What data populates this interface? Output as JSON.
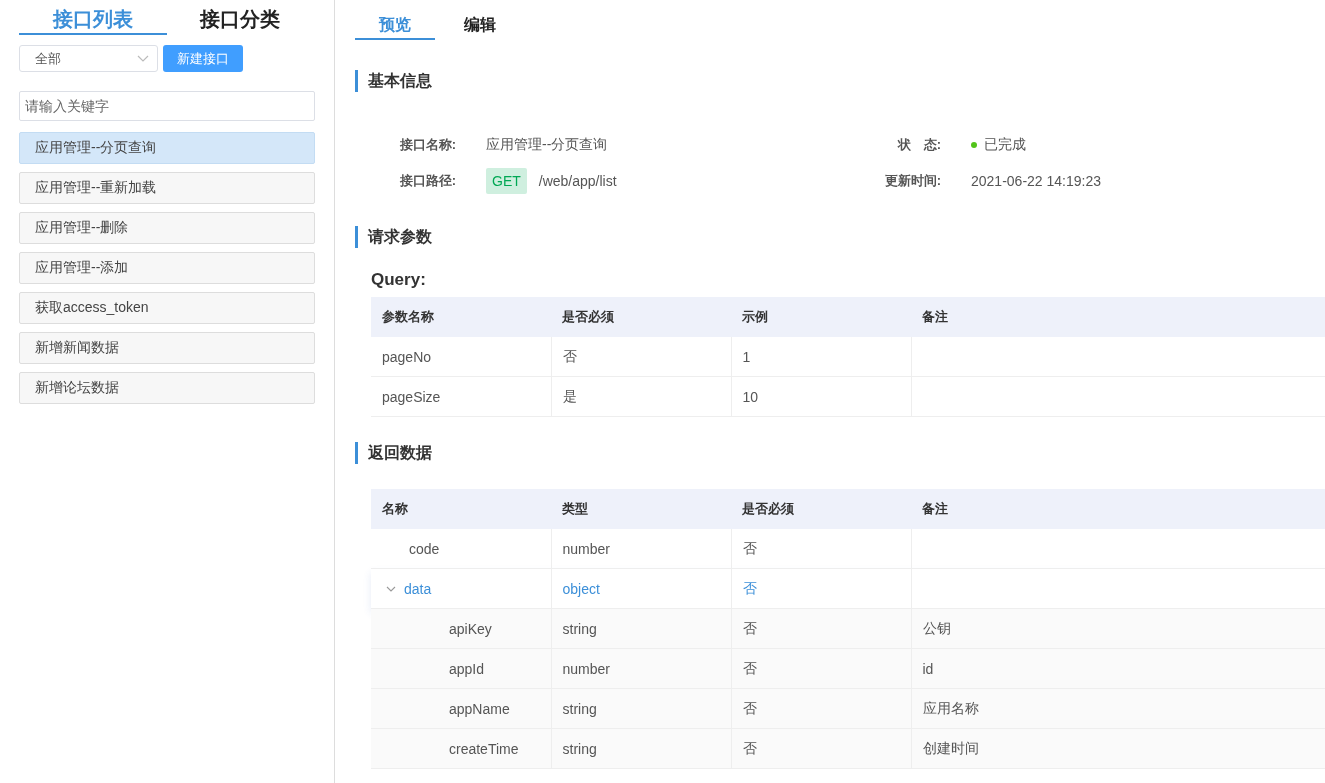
{
  "sidebar": {
    "tabs": [
      {
        "label": "接口列表",
        "selected": true
      },
      {
        "label": "接口分类",
        "selected": false
      }
    ],
    "filter_select": {
      "value": "全部"
    },
    "new_button": "新建接口",
    "search": {
      "placeholder": "请输入关键字"
    },
    "items": [
      {
        "label": "应用管理--分页查询",
        "selected": true
      },
      {
        "label": "应用管理--重新加载",
        "selected": false
      },
      {
        "label": "应用管理--删除",
        "selected": false
      },
      {
        "label": "应用管理--添加",
        "selected": false
      },
      {
        "label": "获取access_token",
        "selected": false
      },
      {
        "label": "新增新闻数据",
        "selected": false
      },
      {
        "label": "新增论坛数据",
        "selected": false
      }
    ]
  },
  "main": {
    "tabs": [
      {
        "label": "预览",
        "selected": true
      },
      {
        "label": "编辑",
        "selected": false
      }
    ],
    "basic_info": {
      "title": "基本信息",
      "name_label": "接口名称:",
      "name_value": "应用管理--分页查询",
      "status_label": "状　态:",
      "status": "已完成",
      "path_label": "接口路径:",
      "method": "GET",
      "path": "/web/app/list",
      "updated_label": "更新时间:",
      "updated_value": "2021-06-22 14:19:23"
    },
    "request_params": {
      "title": "请求参数",
      "query_title": "Query:",
      "table": {
        "columns": [
          "参数名称",
          "是否必须",
          "示例",
          "备注"
        ],
        "rows": [
          [
            "pageNo",
            "否",
            "1",
            ""
          ],
          [
            "pageSize",
            "是",
            "10",
            ""
          ]
        ]
      }
    },
    "response": {
      "title": "返回数据",
      "table": {
        "columns": [
          "名称",
          "类型",
          "是否必须",
          "备注"
        ],
        "rows": [
          {
            "name": "code",
            "type": "number",
            "required": "否",
            "note": "",
            "selected": false
          },
          {
            "name": "data",
            "type": "object",
            "required": "否",
            "note": "",
            "selected": true,
            "expanded": true,
            "children": [
              {
                "name": "apiKey",
                "type": "string",
                "required": "否",
                "note": "公钥",
                "selected": false
              },
              {
                "name": "appId",
                "type": "number",
                "required": "否",
                "note": "id",
                "selected": false
              },
              {
                "name": "appName",
                "type": "string",
                "required": "否",
                "note": "应用名称",
                "selected": false
              },
              {
                "name": "createTime",
                "type": "string",
                "required": "否",
                "note": "创建时间",
                "selected": false
              }
            ]
          }
        ]
      }
    }
  }
}
